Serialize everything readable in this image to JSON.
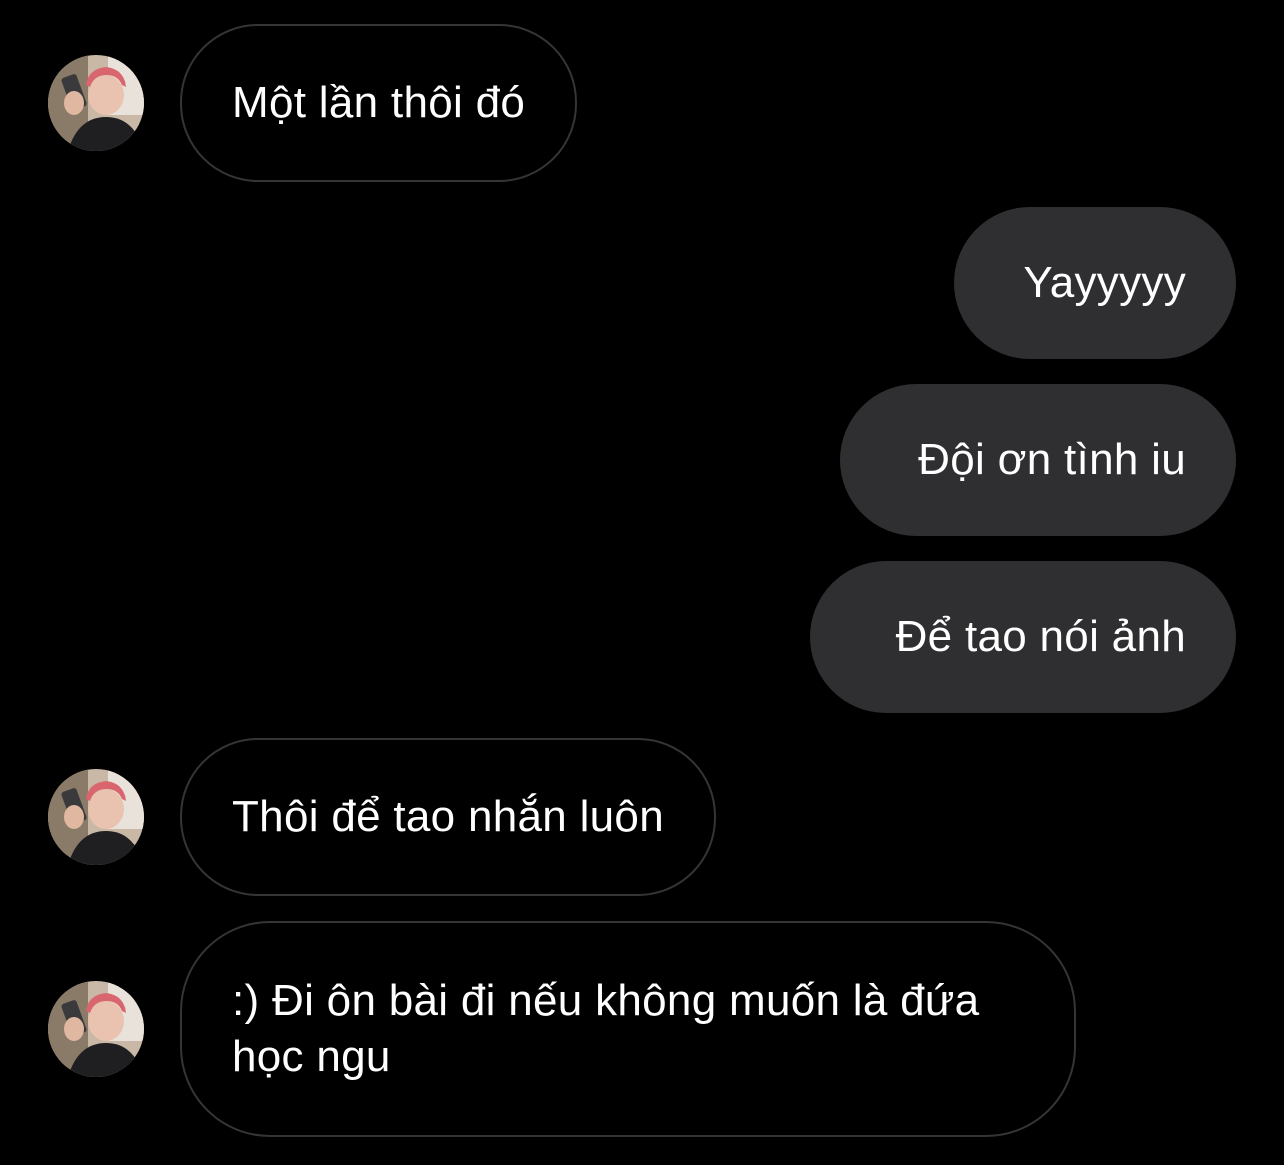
{
  "colors": {
    "background": "#000000",
    "incoming_border": "#353537",
    "outgoing_fill": "#2f2f31",
    "text": "#ffffff"
  },
  "messages": [
    {
      "side": "incoming",
      "text": "Một lần thôi đó",
      "has_avatar": true
    },
    {
      "side": "outgoing",
      "text": "Yayyyyy"
    },
    {
      "side": "outgoing",
      "text": "Đội ơn tình iu"
    },
    {
      "side": "outgoing",
      "text": "Để tao nói ảnh"
    },
    {
      "side": "incoming",
      "text": "Thôi để tao nhắn luôn",
      "has_avatar": true
    },
    {
      "side": "incoming",
      "text": ":) Đi ôn bài đi nếu không muốn là đứa học ngu",
      "has_avatar": true
    }
  ],
  "avatar": {
    "icon": "profile-photo-avatar"
  }
}
